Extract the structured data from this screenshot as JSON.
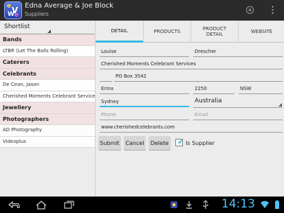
{
  "app": {
    "title": "Edna Average & Joe Block",
    "subtitle": "Suppliers",
    "icon_letters": [
      "e",
      "V",
      "W",
      "e"
    ]
  },
  "left": {
    "spinner_value": "Shortlist",
    "rows": [
      {
        "type": "header",
        "label": "Bands"
      },
      {
        "type": "item",
        "label": "LTBR (Let The Balls Rolling)"
      },
      {
        "type": "header",
        "label": "Caterers"
      },
      {
        "type": "header",
        "label": "Celebrants"
      },
      {
        "type": "item",
        "label": "De Cean, Jason"
      },
      {
        "type": "item",
        "label": "Cherished Moments Celebrant Services"
      },
      {
        "type": "header",
        "label": "Jewellery"
      },
      {
        "type": "header",
        "label": "Photographers"
      },
      {
        "type": "item",
        "label": "AD Photography"
      },
      {
        "type": "item",
        "label": "Videoplus"
      }
    ]
  },
  "tabs": [
    "DETAIL",
    "PRODUCTS",
    "PRODUCT DETAIL",
    "WEBSITE"
  ],
  "active_tab": "DETAIL",
  "form": {
    "first_name": "Louise",
    "last_name": "Drescher",
    "company": "Cherished Moments Celebrant Services",
    "address1": "",
    "address2": "PO Box 3542",
    "suburb": "Erina",
    "postcode": "2250",
    "state": "NSW",
    "city": "Sydney",
    "country": "Australia",
    "phone_placeholder": "Phone",
    "email_placeholder": "Email",
    "website": "www.cherishedcelebrants.com"
  },
  "buttons": {
    "submit": "Submit",
    "cancel": "Cancel",
    "delete": "Delete"
  },
  "is_supplier": {
    "label": "Is Supplier",
    "checked": true
  },
  "status": {
    "time": "14:13"
  },
  "colors": {
    "accent": "#33b5e5",
    "header_row": "#f1e1e3",
    "action_bar": "#2b2b2b"
  }
}
